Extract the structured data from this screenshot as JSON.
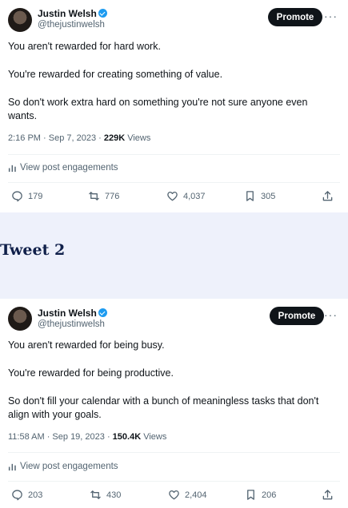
{
  "tweets": [
    {
      "name": "Justin Welsh",
      "handle": "@thejustinwelsh",
      "promote_label": "Promote",
      "more_label": "···",
      "paragraphs": [
        "You aren't rewarded for hard work.",
        "You're rewarded for creating something of value.",
        "So don't work extra hard on something you're not sure anyone even wants."
      ],
      "time": "2:16 PM · Sep 7, 2023 · ",
      "views_count": "229K",
      "views_label": "Views",
      "engagements_label": "View post engagements",
      "replies": "179",
      "reposts": "776",
      "likes": "4,037",
      "bookmarks": "305"
    },
    {
      "name": "Justin Welsh",
      "handle": "@thejustinwelsh",
      "promote_label": "Promote",
      "more_label": "···",
      "paragraphs": [
        "You aren't rewarded for being busy.",
        "You're rewarded for being productive.",
        "So don't fill your calendar with a bunch of meaningless tasks that don't align with your goals."
      ],
      "time": "11:58 AM · Sep 19, 2023 · ",
      "views_count": "150.4K",
      "views_label": "Views",
      "engagements_label": "View post engagements",
      "replies": "203",
      "reposts": "430",
      "likes": "2,404",
      "bookmarks": "206"
    }
  ],
  "section_title": "Tweet 2",
  "colors": {
    "accent_blue": "#1d9bf0",
    "text_primary": "#0f1419",
    "text_secondary": "#536471",
    "separator_bg": "#eef1fb",
    "heading": "#10204a"
  },
  "icons": [
    "avatar",
    "verified-badge-icon",
    "more-icon",
    "analytics-icon",
    "reply-icon",
    "repost-icon",
    "like-icon",
    "bookmark-icon",
    "share-icon"
  ]
}
